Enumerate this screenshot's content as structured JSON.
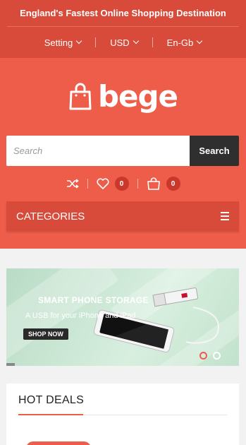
{
  "topbar": {
    "tagline": "England's Fastest Online Shopping Destination",
    "setting_label": "Setting",
    "currency_label": "USD",
    "language_label": "En-Gb"
  },
  "logo": {
    "text": "bege"
  },
  "search": {
    "placeholder": "Search",
    "button_label": "Search"
  },
  "header_icons": {
    "wishlist_count": "0",
    "cart_count": "0"
  },
  "categories": {
    "label": "CATEGORIES"
  },
  "banner": {
    "title": "SMART PHONE STORAGE",
    "subtitle": "A USB for your iPhone and iPad",
    "cta_label": "SHOP NOW",
    "slides": 2,
    "active_slide": 1
  },
  "hot_deals": {
    "title": "HOT DEALS"
  },
  "colors": {
    "primary": "#ee5c4a",
    "dark_primary": "#d84a3a",
    "search_button": "#2f2f2f"
  }
}
